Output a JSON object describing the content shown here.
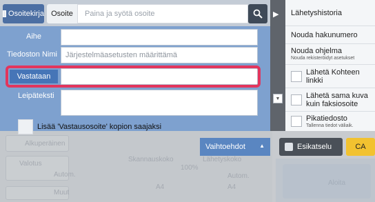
{
  "topbar": {
    "address_book_label": "Osoitekirja",
    "address_label": "Osoite",
    "address_placeholder": "Paina ja syötä osoite",
    "search_icon": "search-icon",
    "address_book_icon": "book-icon"
  },
  "side_menu": {
    "items": [
      {
        "label": "Lähetyshistoria"
      },
      {
        "label": "Nouda hakunumero"
      },
      {
        "label": "Nouda ohjelma",
        "sub": "Nouda rekisteröidyt asetukset"
      },
      {
        "label": "Lähetä Kohteen linkki",
        "checkbox": true
      },
      {
        "label": "Lähetä sama kuva kuin faksiosoite",
        "checkbox": true
      },
      {
        "label": "Pikatiedosto",
        "sub": "Tallenna tiedot väliaik.",
        "checkbox": true
      }
    ]
  },
  "form": {
    "subject_label": "Aihe",
    "filename_label": "Tiedoston Nimi",
    "filename_placeholder": "Järjestelmäasetusten määrittämä",
    "reply_to_label": "Vastataan",
    "body_label": "Leipäteksti",
    "add_reply_label": "Lisää 'Vastausosoite' kopion saajaksi",
    "advanced_label": "Vaihtoehdot"
  },
  "background": {
    "original_label": "Alkuperäinen",
    "exposure_label": "Valotus",
    "auto1": "Autom.",
    "scan_size_label": "Skannauskoko",
    "send_size_label": "Lähetyskoko",
    "percent": "100%",
    "auto2": "Autom.",
    "a4_1": "A4",
    "a4_2": "A4",
    "other_label": "Muut",
    "start_label": "Aloita"
  },
  "actions": {
    "preview_label": "Esikatselu",
    "ca_label": "CA"
  },
  "colors": {
    "form_bg": "#7ea1cf",
    "highlight": "#e2355d",
    "ca": "#f2c230",
    "preview": "#4a5058"
  }
}
